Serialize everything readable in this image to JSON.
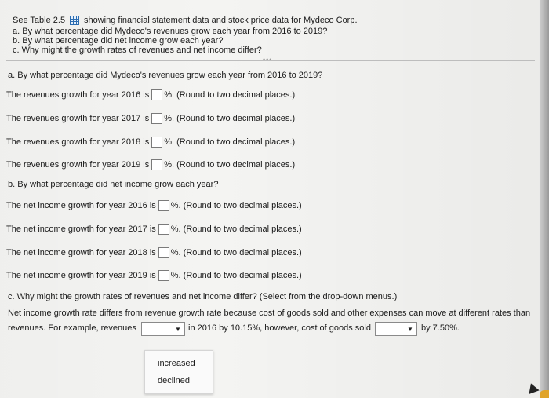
{
  "intro": {
    "line1_pre": "See Table 2.5",
    "line1_post": "showing financial statement data and stock price data for Mydeco Corp.",
    "a": "a. By what percentage did Mydeco's revenues grow each year from 2016 to 2019?",
    "b": "b. By what percentage did net income grow each year?",
    "c": "c. Why might the growth rates of revenues and net income differ?"
  },
  "part_a": {
    "header": "a. By what percentage did Mydeco's revenues grow each year from 2016 to 2019?",
    "rows": [
      {
        "pre": "The revenues growth for year 2016 is",
        "post": "%. (Round to two decimal places.)"
      },
      {
        "pre": "The revenues growth for year 2017 is",
        "post": "%. (Round to two decimal places.)"
      },
      {
        "pre": "The revenues growth for year 2018 is",
        "post": "%. (Round to two decimal places.)"
      },
      {
        "pre": "The revenues growth for year 2019 is",
        "post": "%. (Round to two decimal places.)"
      }
    ]
  },
  "part_b": {
    "header": "b. By what percentage did net income grow each year?",
    "rows": [
      {
        "pre": "The net income growth for year 2016 is",
        "post": "%. (Round to two decimal places.)"
      },
      {
        "pre": "The net income growth for year 2017 is",
        "post": "%. (Round to two decimal places.)"
      },
      {
        "pre": "The net income growth for year 2018 is",
        "post": "%. (Round to two decimal places.)"
      },
      {
        "pre": "The net income growth for year 2019 is",
        "post": "%. (Round to two decimal places.)"
      }
    ]
  },
  "part_c": {
    "header": "c. Why might the growth rates of revenues and net income differ? (Select from the drop-down menus.)",
    "line1": "Net income growth rate differs from revenue growth rate because cost of goods sold and other expenses can move at different rates than",
    "line2_pre": "revenues. For example, revenues",
    "line2_mid": "in 2016 by 10.15%, however, cost of goods sold",
    "line2_post": "by 7.50%.",
    "options": [
      "increased",
      "declined"
    ]
  }
}
